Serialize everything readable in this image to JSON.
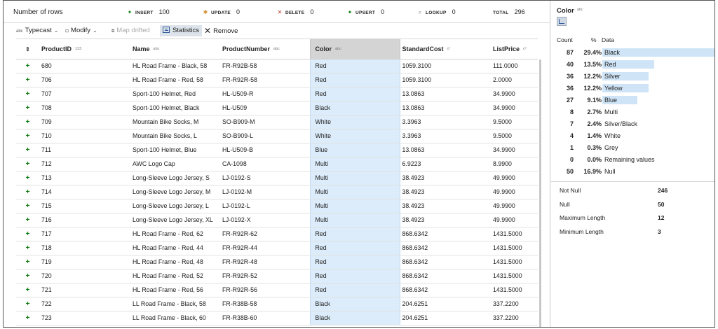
{
  "summary": {
    "rows_label": "Number of rows",
    "insert": {
      "label": "INSERT",
      "value": "100"
    },
    "update": {
      "label": "UPDATE",
      "value": "0"
    },
    "delete": {
      "label": "DELETE",
      "value": "0"
    },
    "upsert": {
      "label": "UPSERT",
      "value": "0"
    },
    "lookup": {
      "label": "LOOKUP",
      "value": "0"
    },
    "total": {
      "label": "TOTAL",
      "value": "296"
    }
  },
  "toolbar": {
    "typecast_prefix": "abc",
    "typecast": "Typecast",
    "modify": "Modify",
    "map_drifted": "Map drifted",
    "statistics": "Statistics",
    "remove": "Remove"
  },
  "table": {
    "columns": [
      {
        "label": "ProductID",
        "type": "123"
      },
      {
        "label": "Name",
        "type": "abc"
      },
      {
        "label": "ProductNumber",
        "type": "abc"
      },
      {
        "label": "Color",
        "type": "abc"
      },
      {
        "label": "StandardCost",
        "type": "c²"
      },
      {
        "label": "ListPrice",
        "type": "c²"
      }
    ],
    "rows": [
      [
        "680",
        "HL Road Frame - Black, 58",
        "FR-R92B-58",
        "Red",
        "1059.3100",
        "111.0000"
      ],
      [
        "706",
        "HL Road Frame - Red, 58",
        "FR-R92R-58",
        "Red",
        "1059.3100",
        "2.0000"
      ],
      [
        "707",
        "Sport-100 Helmet, Red",
        "HL-U509-R",
        "Red",
        "13.0863",
        "34.9900"
      ],
      [
        "708",
        "Sport-100 Helmet, Black",
        "HL-U509",
        "Black",
        "13.0863",
        "34.9900"
      ],
      [
        "709",
        "Mountain Bike Socks, M",
        "SO-B909-M",
        "White",
        "3.3963",
        "9.5000"
      ],
      [
        "710",
        "Mountain Bike Socks, L",
        "SO-B909-L",
        "White",
        "3.3963",
        "9.5000"
      ],
      [
        "711",
        "Sport-100 Helmet, Blue",
        "HL-U509-B",
        "Blue",
        "13.0863",
        "34.9900"
      ],
      [
        "712",
        "AWC Logo Cap",
        "CA-1098",
        "Multi",
        "6.9223",
        "8.9900"
      ],
      [
        "713",
        "Long-Sleeve Logo Jersey, S",
        "LJ-0192-S",
        "Multi",
        "38.4923",
        "49.9900"
      ],
      [
        "714",
        "Long-Sleeve Logo Jersey, M",
        "LJ-0192-M",
        "Multi",
        "38.4923",
        "49.9900"
      ],
      [
        "715",
        "Long-Sleeve Logo Jersey, L",
        "LJ-0192-L",
        "Multi",
        "38.4923",
        "49.9900"
      ],
      [
        "716",
        "Long-Sleeve Logo Jersey, XL",
        "LJ-0192-X",
        "Multi",
        "38.4923",
        "49.9900"
      ],
      [
        "717",
        "HL Road Frame - Red, 62",
        "FR-R92R-62",
        "Red",
        "868.6342",
        "1431.5000"
      ],
      [
        "718",
        "HL Road Frame - Red, 44",
        "FR-R92R-44",
        "Red",
        "868.6342",
        "1431.5000"
      ],
      [
        "719",
        "HL Road Frame - Red, 48",
        "FR-R92R-48",
        "Red",
        "868.6342",
        "1431.5000"
      ],
      [
        "720",
        "HL Road Frame - Red, 52",
        "FR-R92R-52",
        "Red",
        "868.6342",
        "1431.5000"
      ],
      [
        "721",
        "HL Road Frame - Red, 56",
        "FR-R92R-56",
        "Red",
        "868.6342",
        "1431.5000"
      ],
      [
        "722",
        "LL Road Frame - Black, 58",
        "FR-R38B-58",
        "Black",
        "204.6251",
        "337.2200"
      ],
      [
        "723",
        "LL Road Frame - Black, 60",
        "FR-R38B-60",
        "Black",
        "204.6251",
        "337.2200"
      ]
    ]
  },
  "stats": {
    "title": "Color",
    "title_type": "abc",
    "headers": {
      "count": "Count",
      "pct": "%",
      "data": "Data"
    },
    "distribution": [
      {
        "count": "87",
        "pct": "29.4%",
        "value": "Black",
        "fraction": 1.0
      },
      {
        "count": "40",
        "pct": "13.5%",
        "value": "Red",
        "fraction": 0.46
      },
      {
        "count": "36",
        "pct": "12.2%",
        "value": "Silver",
        "fraction": 0.41
      },
      {
        "count": "36",
        "pct": "12.2%",
        "value": "Yellow",
        "fraction": 0.41
      },
      {
        "count": "27",
        "pct": "9.1%",
        "value": "Blue",
        "fraction": 0.31
      },
      {
        "count": "8",
        "pct": "2.7%",
        "value": "Multi",
        "fraction": 0.0
      },
      {
        "count": "7",
        "pct": "2.4%",
        "value": "Silver/Black",
        "fraction": 0.0
      },
      {
        "count": "4",
        "pct": "1.4%",
        "value": "White",
        "fraction": 0.0
      },
      {
        "count": "1",
        "pct": "0.3%",
        "value": "Grey",
        "fraction": 0.0
      },
      {
        "count": "0",
        "pct": "0.0%",
        "value": "Remaining values",
        "fraction": 0.0
      },
      {
        "count": "50",
        "pct": "16.9%",
        "value": "Null",
        "fraction": 0.0
      }
    ],
    "metrics": [
      {
        "label": "Not Null",
        "value": "246"
      },
      {
        "label": "Null",
        "value": "50"
      },
      {
        "label": "Maximum Length",
        "value": "12"
      },
      {
        "label": "Minimum Length",
        "value": "3"
      }
    ]
  }
}
